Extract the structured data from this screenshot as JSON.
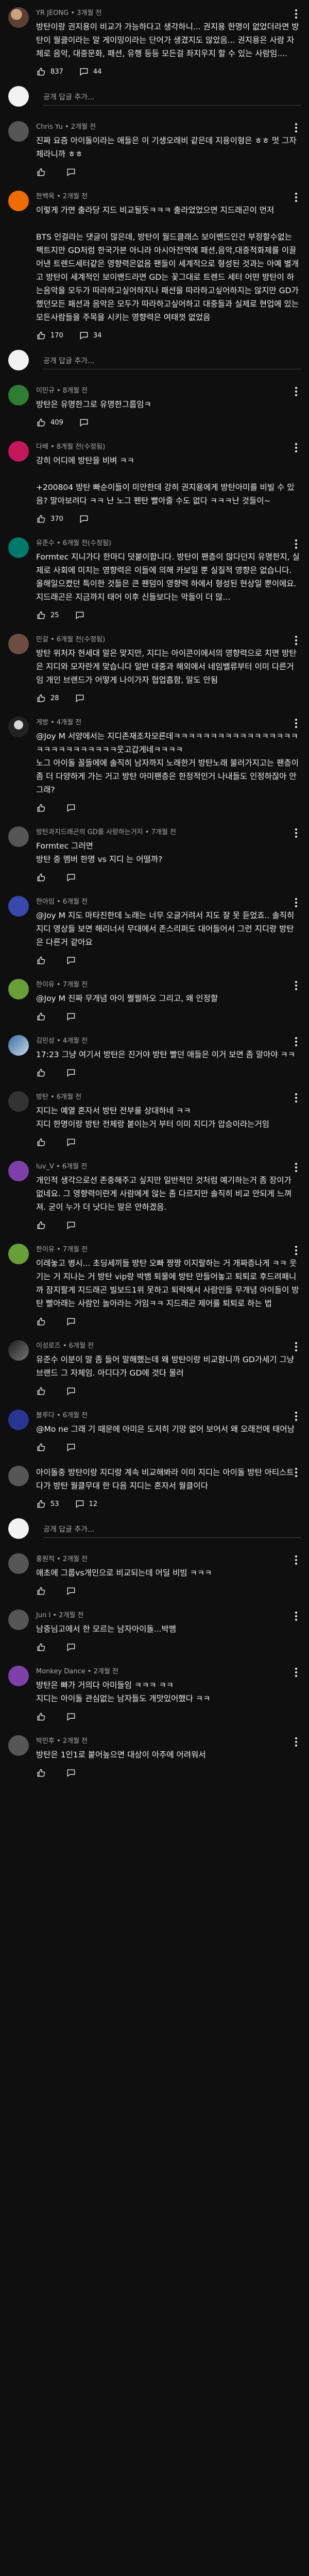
{
  "reply_placeholder": "공개 답글 추가...",
  "comments": [
    {
      "author": "YR JEONG",
      "time": "3개월 전",
      "text": "방탄이랑 권지용이 비교가 가능하다고 생각하니... 권지용 한명이 없었더라면 방탄이 월클이라는 말 게이밍이라는 단어가 생겼지도 않았음... 권지용은 사람 자체로 음악, 대중문화, 패션, 유행 등등 모든걸 좌지우지 할 수 있는 사람임....",
      "likes": "837",
      "replies": "44",
      "avatar": "av-photo"
    },
    {
      "author": "Chris Yu",
      "time": "2개월 전",
      "text": "진짜 요즘 아이돌이라는 애들은 이 기생오래비 같은데 지용이형은 ㅎㅎ 멋 그자체라니까 ㅎㅎ",
      "likes": "",
      "replies": "",
      "avatar": "av-grey"
    },
    {
      "author": "한백옥",
      "time": "2개월 전",
      "text": "이렇게 가면 출라당 지드 비교될듯ㅋㅋㅋ 출라었었으면 지드래곤이 먼저\n\nBTS 인걸라는 댓글이 많은데, 방탄이 월드클래스 보이밴드인건 부정할수없는 팩트지만 GD처럼 한국가본 아니라 아시아전역에 패션,음악,대중적화제를 이끌어낸 트렌드세터같은 영향력은없음 팬들이 세계적으로 형성된 것과는 아예 별개고 방탄이 세계적인 보이밴드라면 GD는 꽃그대로 트렌드 세터 어떤 방탄이 하는음악을 모두가 따라하고싶어하지나 패션을 따라하고싶어하지는 않지만 GD가 했던모든 패션과 음악은 모두가 따라하고싶어하고 대중들과 실제로 현업에 있는 모든사람들을 주목을 시키는 영향력은 여태껏 없었음",
      "likes": "170",
      "replies": "34",
      "avatar": "av-orange"
    },
    {
      "author": "이민규",
      "time": "8개월 전",
      "text": "방탄은 유명한그로 유명한그룹임ㅋ",
      "likes": "409",
      "replies": "",
      "avatar": "av-green"
    },
    {
      "author": "다배",
      "time": "8개월 전(수정됨)",
      "text": "강히 어디에 방탄을 비벼 ㅋㅋ\n\n+200804 방탄 빠순이들이 미안한데 강히 권지용에게 방탄아미를 비빌 수 있음? 말아보려다 ㅋㅋ 난 노그 펜탄 빨아줄 수도 없다 ㅋㅋㅋ난 것들이~",
      "likes": "370",
      "replies": "",
      "avatar": "av-pink"
    },
    {
      "author": "유준수",
      "time": "6개월 전(수정됨)",
      "text": "Formtec 지니가다 한마디 덧붙이합니다. 방탄이 팬층이 많다던지 유명한지, 실제로 사회에 미치는 영향력은 이들에 의해 카보일 뿐 실질적 영향은 없습니다. 올해일으켰던 특이한 것들은 큰 팬덤이 영향력 하에서 형성된 현상일 뿐이에요. 지드래곤은 지금까지 태어 이후 신들보다는 악들이 더 많...",
      "likes": "25",
      "replies": "",
      "avatar": "av-teal"
    },
    {
      "author": "민갈",
      "time": "6개월 전(수정됨)",
      "text": "방탄 위처자 현세대 말은 맞지만, 지디는 아이콘이에서의 영향력으로 치면 방탄은 지디와 모자란게 맞습니다 일반 대중과 해외에서 네임밸류부터 이미 다른거임 개인 브랜드가 어떻게 나이가자 협업흡함, 말도 안됨",
      "likes": "28",
      "replies": "",
      "avatar": "av-brown"
    },
    {
      "author": "게방",
      "time": "4개월 전",
      "text": "@Joy M 서양에서는 지디존재조차모른데ㅋㅋㅋㅋㅋㅋㅋㅋㅋㅋㅋㅋㅋㅋㅋㅋㅋㅋㅋㅋㅋㅋㅋㅋㅋㅋㅋㅋ웃고갑게네ㅋㅋㅋㅋ\n노그 아이돌 꼴들에에 솔직히 남자까지 노래한거 방탄노래 불러가지고는 팬층이 좀 더 다양하게 가는 거고 방탄 아미팬층은 한정적인거 나내들도 인정하잖아 안그래?",
      "likes": "",
      "replies": "",
      "avatar": "av-photo2"
    },
    {
      "author": "방탄과지드래곤의 GD를 사랑하는거지",
      "time": "7개월 전",
      "text": "Formtec 그러면\n방탄 중 멤버 한명 vs 지디 는 어떨까?",
      "likes": "",
      "replies": "",
      "avatar": "av-grey"
    },
    {
      "author": "한아임",
      "time": "6개월 전",
      "text": "@Joy M 지도 마타진한데 노래는 너무 오글거려서 지도 잘 못 듣었죠.. 솔직히 지디 영상들 보면 해리너서 무대에서 존스리퍼도 대어들어서 그런 지디랑 방탄은 다른거 같아요",
      "likes": "",
      "replies": "",
      "avatar": "av-blue"
    },
    {
      "author": "한이유",
      "time": "7개월 전",
      "text": "@Joy M 진짜 무개념 아이 쩔쩔하오 그리고, 왜 인정할",
      "likes": "",
      "replies": "",
      "avatar": "av-lime"
    },
    {
      "author": "김민성",
      "time": "4개월 전",
      "text": "17:23 그냥 여기서 방탄은 진거야 방탄 빨던 애들은 이거 보면 좀 알아야 ㅋㅋ",
      "likes": "",
      "replies": "",
      "avatar": "av-photo3"
    },
    {
      "author": "방탄",
      "time": "6개월 전",
      "text": "지디는 예열 혼자서 방탄 전부를 상대하네 ㅋㅋ\n지디 한명이랑 방탄 전체랑 붙이는거 부터 이미 지디가 압승이라는거임",
      "likes": "",
      "replies": "",
      "avatar": "av-dark"
    },
    {
      "author": "luv_V",
      "time": "6개월 전",
      "text": "개인적 생각으로선 존중해주고 싶지만 일반적인 것처럼 예기하는거 좀 장이가 없네요. 그 영향력이란게 사람에게 않는 좀 다르지만 솔직히 비교 안되게 느껴져. 굳이 누가 더 낫다는 말은 안하겠음.",
      "likes": "",
      "replies": "",
      "avatar": "av-purple"
    },
    {
      "author": "한이유",
      "time": "7개월 전",
      "text": "이레놓고 병시... 초딩세끼들 방탄 오빠 짱짱 이지랄하는 거 개짜증나게 ㅋㅋ 웃기는 거 지나는 거 방탄 vip랑 박뱀 퇴물에 방탄 만들어놓고 퇴퇴로 후드려패니까 잠지팔게 지드래곤 빌보드1위 못하고 퇴락해서 사람인들 무개념 아이들이 방탄 빨아래는 사람인 놀아라는 거임ㅋㅋ 지드래곤 제어를 퇴퇴로 하는 법",
      "likes": "",
      "replies": "",
      "avatar": "av-lime"
    },
    {
      "author": "이성로즈",
      "time": "6개월 전",
      "text": "유준수 이분이 말 좀 들어 말해했는데 왜 방탄이랑 비교함니까 GD가세기 그냥 브랜드 그 자체임. 아디다가 GD에 것다 물러",
      "likes": "",
      "replies": "",
      "avatar": "av-photo4"
    },
    {
      "author": "블루다",
      "time": "6개월 전",
      "text": "@Mo ne 그래 기 때문에 아미은 도저히 기망 없어 보어서 왜 오래전에 태어남",
      "likes": "",
      "replies": "",
      "avatar": "av-indigo"
    },
    {
      "author": "",
      "time": "",
      "text": "아이돌중 방탄이랑 지디랑 계속 비교해봐라 이미 지디는 아이돌 방탄 아티스트다가 방탄 월클무대 한 다음 지디는 혼자서 월클이다",
      "likes": "53",
      "replies": "12",
      "avatar": ""
    },
    {
      "author": "홍원적",
      "time": "2개월 전",
      "text": "애초에 그룹vs개인으로 비교되는데 어딜 비빔 ㅋㅋㅋ",
      "likes": "",
      "replies": "",
      "avatar": "av-grey"
    },
    {
      "author": "Jun I",
      "time": "2개월 전",
      "text": "남중님고에서 한 모르는 남자아이돌...박뱀",
      "likes": "",
      "replies": "",
      "avatar": "av-grey"
    },
    {
      "author": "Monkey Dance",
      "time": "2개월 전",
      "text": "방탄은 빠가 거의다 아미들임 ㅋㅋㅋ ㅋㅋ\n지디는 아이돌 관심없는 남자들도 개맛있어했다 ㅋㅋ",
      "likes": "",
      "replies": "",
      "avatar": "av-purple"
    },
    {
      "author": "박민후",
      "time": "2개월 전",
      "text": "방탄은 1인1로 붙어높으면 대상이 아주에 어려워서",
      "likes": "",
      "replies": "",
      "avatar": "av-grey"
    }
  ]
}
